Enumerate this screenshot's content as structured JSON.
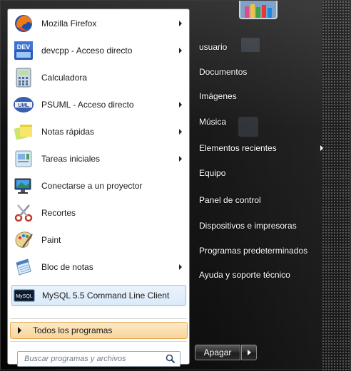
{
  "programs": [
    {
      "label": "Mozilla Firefox",
      "icon": "firefox-icon",
      "arrow": true
    },
    {
      "label": "devcpp - Acceso directo",
      "icon": "devcpp-icon",
      "arrow": true
    },
    {
      "label": "Calculadora",
      "icon": "calculator-icon",
      "arrow": false
    },
    {
      "label": "PSUML - Acceso directo",
      "icon": "psuml-icon",
      "arrow": true
    },
    {
      "label": "Notas rápidas",
      "icon": "sticky-notes-icon",
      "arrow": true
    },
    {
      "label": "Tareas iniciales",
      "icon": "getting-started-icon",
      "arrow": true
    },
    {
      "label": "Conectarse a un proyector",
      "icon": "projector-icon",
      "arrow": false
    },
    {
      "label": "Recortes",
      "icon": "snipping-tool-icon",
      "arrow": false
    },
    {
      "label": "Paint",
      "icon": "paint-icon",
      "arrow": false
    },
    {
      "label": "Bloc de notas",
      "icon": "notepad-icon",
      "arrow": true
    },
    {
      "label": "MySQL 5.5 Command Line Client",
      "icon": "mysql-icon",
      "arrow": false,
      "highlighted": true
    }
  ],
  "all_programs_label": "Todos los programas",
  "search": {
    "placeholder": "Buscar programas y archivos"
  },
  "right_links": [
    {
      "label": "usuario",
      "arrow": false
    },
    {
      "label": "Documentos",
      "arrow": false
    },
    {
      "label": "Imágenes",
      "arrow": false
    },
    {
      "label": "Música",
      "arrow": false
    },
    {
      "label": "Elementos recientes",
      "arrow": true
    },
    {
      "label": "Equipo",
      "arrow": false
    },
    {
      "label": "Panel de control",
      "arrow": false
    },
    {
      "label": "Dispositivos e impresoras",
      "arrow": false
    },
    {
      "label": "Programas predeterminados",
      "arrow": false
    },
    {
      "label": "Ayuda y soporte técnico",
      "arrow": false
    }
  ],
  "shutdown_label": "Apagar",
  "colors": {
    "highlight_border": "#9ac0e8",
    "all_programs_bg": "#f8d49a"
  }
}
